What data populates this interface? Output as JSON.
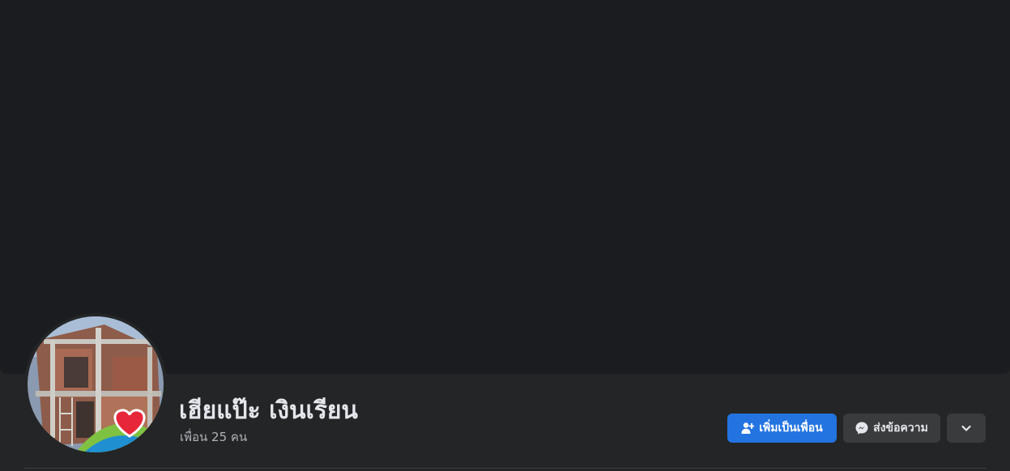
{
  "profile": {
    "name": "เฮียแป๊ะ เงินเรียน",
    "friends_count": "เพื่อน 25 คน"
  },
  "actions": {
    "add_friend_label": "เพิ่มเป็นเพื่อน",
    "message_label": "ส่งข้อความ",
    "more_icon": "chevron-down-icon",
    "add_friend_icon": "person-add-icon",
    "message_icon": "messenger-icon"
  },
  "colors": {
    "background": "#242526",
    "cover": "#1b1c1f",
    "primary_button": "#2374e1",
    "secondary_button": "#3a3b3c",
    "text_primary": "#e4e6eb",
    "text_secondary": "#b0b3b8"
  }
}
